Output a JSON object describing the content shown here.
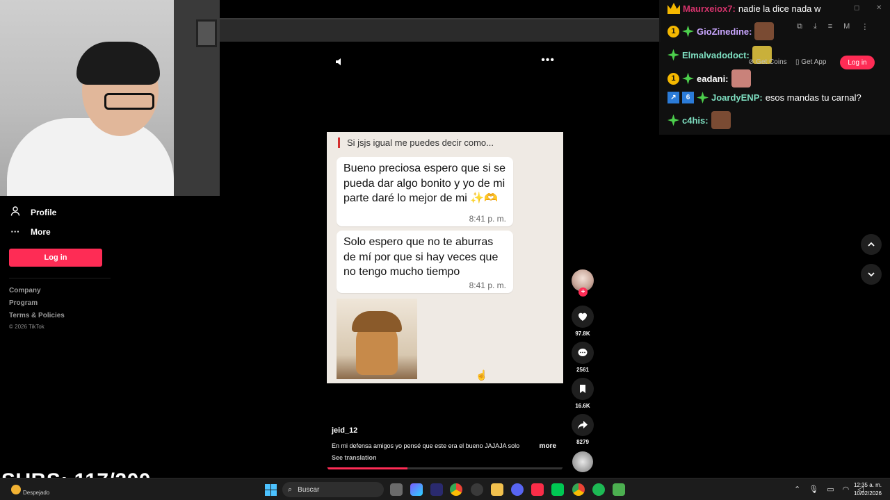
{
  "sidebar": {
    "items": [
      {
        "label": "Profile",
        "icon": "person-icon"
      },
      {
        "label": "More",
        "icon": "ellipsis-icon"
      }
    ],
    "login_label": "Log in",
    "footer_links": [
      "Company",
      "Program",
      "Terms & Policies"
    ],
    "copyright": "© 2026 TikTok"
  },
  "video": {
    "quoted_text": "Si jsjs igual me puedes decir como...",
    "messages": [
      {
        "text": "Bueno preciosa espero que si se pueda dar algo bonito y yo de mi parte daré lo mejor de mi ✨🫶",
        "time": "8:41 p. m."
      },
      {
        "text": "Solo espero que no te aburras de mí por que si hay veces que no tengo mucho tiempo",
        "time": "8:41 p. m."
      }
    ],
    "username": "jeid_12",
    "caption": "En mi defensa amigos yo pensé que este era el bueno JAJAJA solo",
    "caption_more": "more",
    "see_translation": "See translation",
    "progress_fraction": 0.34
  },
  "actions": {
    "likes": "97.8K",
    "comments": "2561",
    "saves": "16.6K",
    "shares": "8279"
  },
  "header": {
    "get_coins": "Get Coins",
    "get_app": "Get App",
    "login_label": "Log in"
  },
  "chat": [
    {
      "badges": [
        "crown"
      ],
      "user": "Maurxeiox7:",
      "user_color": "#d6336c",
      "message": "nadie la dice nada w"
    },
    {
      "badges": [
        "one",
        "gem"
      ],
      "user": "GioZinedine:",
      "user_color": "#c9a6ff",
      "message": "",
      "emote": true
    },
    {
      "badges": [
        "gem"
      ],
      "user": "Elmalvadodoct:",
      "user_color": "#7fe0c2",
      "message": "",
      "emote": true
    },
    {
      "badges": [
        "one",
        "gem"
      ],
      "user": "eadani:",
      "user_color": "#ffffff",
      "message": "",
      "emote": true
    },
    {
      "badges": [
        "box",
        "box",
        "gem"
      ],
      "user": "JoardyENP:",
      "user_color": "#7fe0c2",
      "message": "esos mandas tu carnal?"
    },
    {
      "badges": [
        "gem"
      ],
      "user": "c4his:",
      "user_color": "#7fe0c2",
      "message": "",
      "emote": true
    }
  ],
  "overlay": {
    "subs": "SUBS: 117/200"
  },
  "taskbar": {
    "weather": "Despejado",
    "search_placeholder": "Buscar",
    "time": "12:35 a. m.",
    "date": "10/02/2026"
  },
  "colors": {
    "accent": "#fe2c55",
    "chat_bg": "#121212",
    "chat_screen_bg": "#efeae4"
  }
}
